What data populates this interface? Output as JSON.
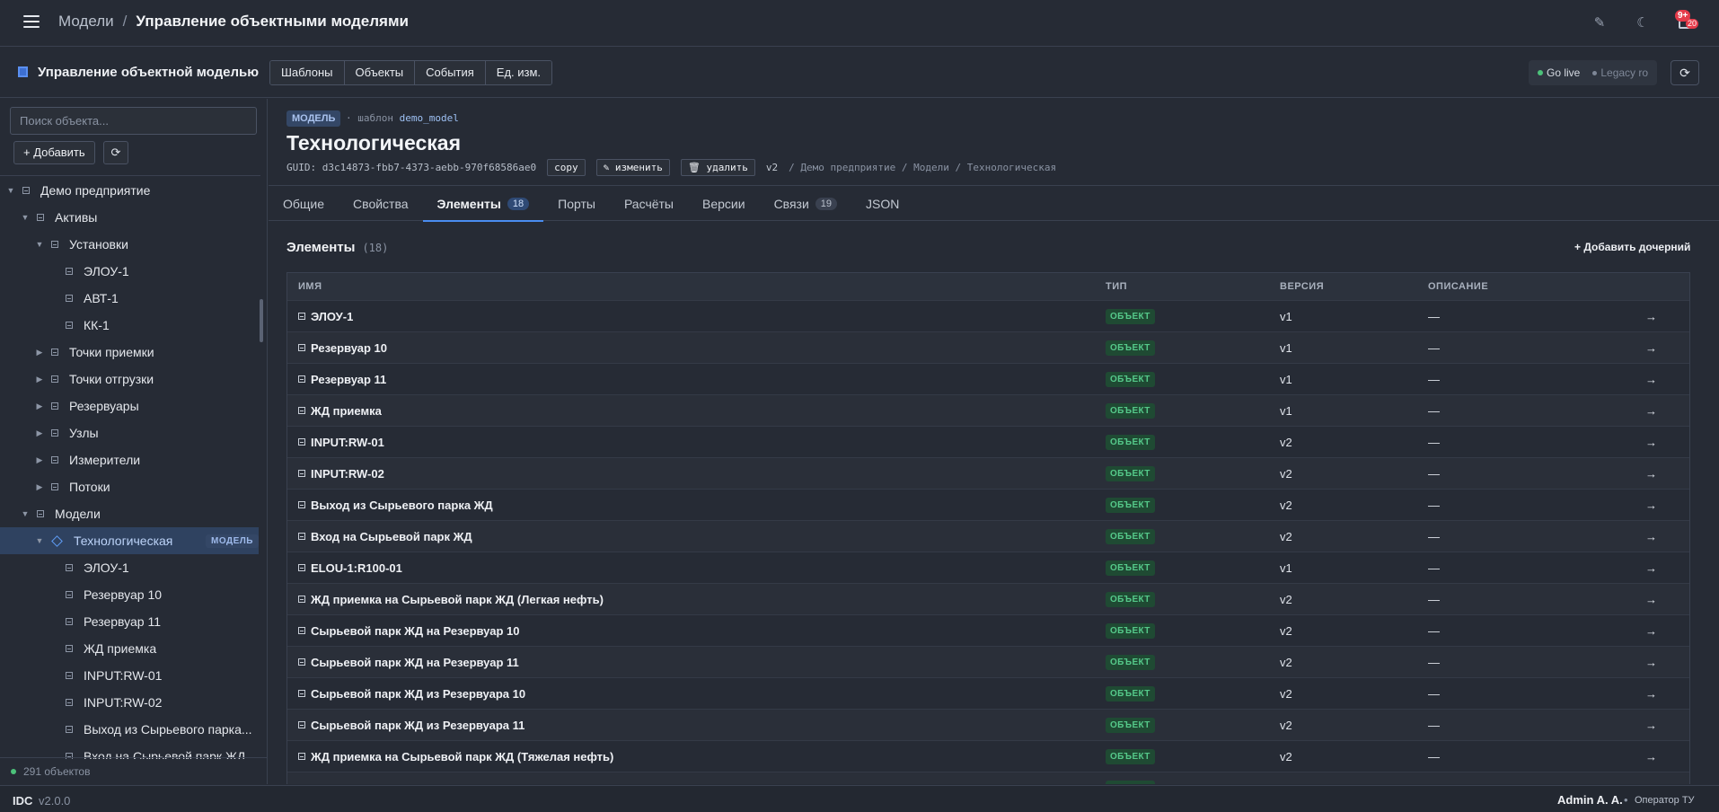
{
  "topbar": {
    "breadcrumb_root": "Модели",
    "breadcrumb_sep": "/",
    "breadcrumb_current": "Управление объектными моделями",
    "notifications_badge": "9+",
    "notifications_sub": "20"
  },
  "subbar": {
    "title": "Управление объектной моделью",
    "nav": [
      "Шаблоны",
      "Объекты",
      "События",
      "Ед. изм."
    ],
    "go_live": "Go live",
    "legacy": "Legacy ro"
  },
  "sidebar": {
    "search_placeholder": "Поиск объекта...",
    "add_label": "+ Добавить",
    "footer": "291 объектов",
    "tree": [
      {
        "label": "Демо предприятие",
        "level": 0,
        "caret": "open"
      },
      {
        "label": "Активы",
        "level": 1,
        "caret": "open"
      },
      {
        "label": "Установки",
        "level": 2,
        "caret": "open"
      },
      {
        "label": "ЭЛОУ-1",
        "level": 3,
        "caret": "none"
      },
      {
        "label": "АВТ-1",
        "level": 3,
        "caret": "none"
      },
      {
        "label": "КК-1",
        "level": 3,
        "caret": "none"
      },
      {
        "label": "Точки приемки",
        "level": 2,
        "caret": "closed"
      },
      {
        "label": "Точки отгрузки",
        "level": 2,
        "caret": "closed"
      },
      {
        "label": "Резервуары",
        "level": 2,
        "caret": "closed"
      },
      {
        "label": "Узлы",
        "level": 2,
        "caret": "closed"
      },
      {
        "label": "Измерители",
        "level": 2,
        "caret": "closed"
      },
      {
        "label": "Потоки",
        "level": 2,
        "caret": "closed"
      },
      {
        "label": "Модели",
        "level": 1,
        "caret": "open"
      },
      {
        "label": "Технологическая",
        "level": 2,
        "caret": "open",
        "selected": true,
        "badge": "МОДЕЛЬ"
      },
      {
        "label": "ЭЛОУ-1",
        "level": 3,
        "caret": "none"
      },
      {
        "label": "Резервуар 10",
        "level": 3,
        "caret": "none"
      },
      {
        "label": "Резервуар 11",
        "level": 3,
        "caret": "none"
      },
      {
        "label": "ЖД приемка",
        "level": 3,
        "caret": "none"
      },
      {
        "label": "INPUT:RW-01",
        "level": 3,
        "caret": "none"
      },
      {
        "label": "INPUT:RW-02",
        "level": 3,
        "caret": "none"
      },
      {
        "label": "Выход из Сырьевого парка...",
        "level": 3,
        "caret": "none"
      },
      {
        "label": "Вход на Сырьевой парк ЖД",
        "level": 3,
        "caret": "none"
      }
    ]
  },
  "model": {
    "badge": "МОДЕЛЬ",
    "template_prefix": "· шаблон",
    "template_name": "demo_model",
    "title": "Технологическая",
    "guid": "GUID: d3c14873-fbb7-4373-aebb-970f68586ae0",
    "copy_label": "copy",
    "edit_label": "✎ изменить",
    "delete_label": "🗑 удалить",
    "version": "v2",
    "path": "/ Демо предприятие / Модели / Технологическая"
  },
  "tabs": [
    {
      "label": "Общие",
      "count": ""
    },
    {
      "label": "Свойства",
      "count": ""
    },
    {
      "label": "Элементы",
      "count": "18",
      "active": true
    },
    {
      "label": "Порты",
      "count": ""
    },
    {
      "label": "Расчёты",
      "count": ""
    },
    {
      "label": "Версии",
      "count": ""
    },
    {
      "label": "Связи",
      "count": "19"
    },
    {
      "label": "JSON",
      "count": ""
    }
  ],
  "elements": {
    "title": "Элементы",
    "count": "(18)",
    "add_child": "+ Добавить дочерний",
    "columns": [
      "ИМЯ",
      "ТИП",
      "ВЕРСИЯ",
      "ОПИСАНИЕ"
    ],
    "rows": [
      {
        "name": "ЭЛОУ-1",
        "type": "ОБЪЕКТ",
        "version": "v1",
        "desc": "—"
      },
      {
        "name": "Резервуар 10",
        "type": "ОБЪЕКТ",
        "version": "v1",
        "desc": "—"
      },
      {
        "name": "Резервуар 11",
        "type": "ОБЪЕКТ",
        "version": "v1",
        "desc": "—"
      },
      {
        "name": "ЖД приемка",
        "type": "ОБЪЕКТ",
        "version": "v1",
        "desc": "—"
      },
      {
        "name": "INPUT:RW-01",
        "type": "ОБЪЕКТ",
        "version": "v2",
        "desc": "—"
      },
      {
        "name": "INPUT:RW-02",
        "type": "ОБЪЕКТ",
        "version": "v2",
        "desc": "—"
      },
      {
        "name": "Выход из Сырьевого парка ЖД",
        "type": "ОБЪЕКТ",
        "version": "v2",
        "desc": "—"
      },
      {
        "name": "Вход на Сырьевой парк ЖД",
        "type": "ОБЪЕКТ",
        "version": "v2",
        "desc": "—"
      },
      {
        "name": "ELOU-1:R100-01",
        "type": "ОБЪЕКТ",
        "version": "v1",
        "desc": "—"
      },
      {
        "name": "ЖД приемка на Сырьевой парк ЖД (Легкая нефть)",
        "type": "ОБЪЕКТ",
        "version": "v2",
        "desc": "—"
      },
      {
        "name": "Сырьевой парк ЖД на Резервуар 10",
        "type": "ОБЪЕКТ",
        "version": "v2",
        "desc": "—"
      },
      {
        "name": "Сырьевой парк ЖД на Резервуар 11",
        "type": "ОБЪЕКТ",
        "version": "v2",
        "desc": "—"
      },
      {
        "name": "Сырьевой парк ЖД из Резервуара 10",
        "type": "ОБЪЕКТ",
        "version": "v2",
        "desc": "—"
      },
      {
        "name": "Сырьевой парк ЖД из Резервуара 11",
        "type": "ОБЪЕКТ",
        "version": "v2",
        "desc": "—"
      },
      {
        "name": "ЖД приемка на Сырьевой парк ЖД (Тяжелая нефть)",
        "type": "ОБЪЕКТ",
        "version": "v2",
        "desc": "—"
      },
      {
        "name": "",
        "type": "ОБЪЕКТ",
        "version": "",
        "desc": ""
      }
    ]
  },
  "footer": {
    "app": "IDC",
    "version": "v2.0.0",
    "user": "Admin A. A.",
    "sep": "•",
    "role": "Оператор ТУ"
  }
}
